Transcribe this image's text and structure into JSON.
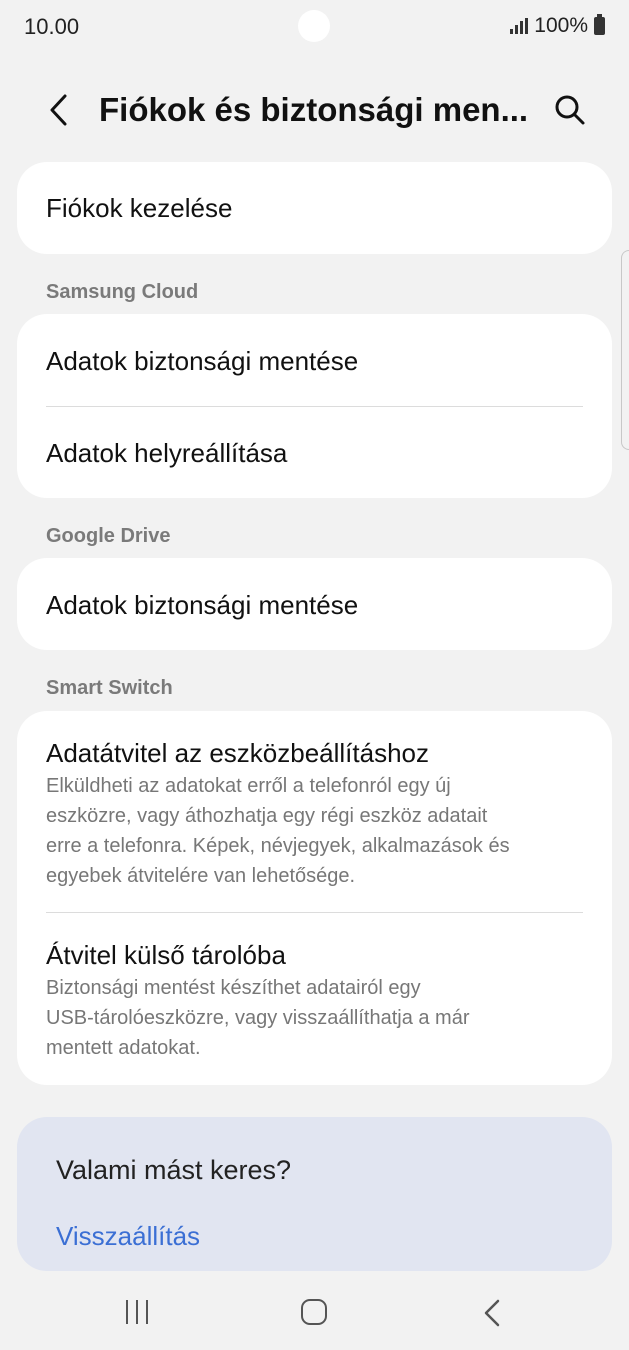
{
  "status_bar": {
    "time": "10.00",
    "battery": "100%"
  },
  "header": {
    "title": "Fiókok és biztonsági men...",
    "back_icon": "chevron-left-icon",
    "search_icon": "search-icon"
  },
  "manage_accounts": {
    "label": "Fiókok kezelése"
  },
  "samsung_cloud": {
    "section_label": "Samsung Cloud",
    "items": [
      {
        "title": "Adatok biztonsági mentése"
      },
      {
        "title": "Adatok helyreállítása"
      }
    ]
  },
  "google_drive": {
    "section_label": "Google Drive",
    "items": [
      {
        "title": "Adatok biztonsági mentése"
      }
    ]
  },
  "smart_switch": {
    "section_label": "Smart Switch",
    "items": [
      {
        "title": "Adatátvitel az eszközbeállításhoz",
        "desc_lines": [
          "Elküldheti az adatokat erről a telefonról egy új",
          "eszközre, vagy áthozhatja egy régi eszköz adatait",
          "erre a telefonra. Képek, névjegyek, alkalmazások és",
          "egyebek átvitelére van lehetősége."
        ]
      },
      {
        "title": "Átvitel külső tárolóba",
        "desc_lines": [
          "Biztonsági mentést készíthet adatairól egy",
          "USB-tárolóeszközre, vagy visszaállíthatja a már",
          "mentett adatokat."
        ]
      }
    ]
  },
  "suggestion": {
    "title": "Valami mást keres?",
    "link": "Visszaállítás"
  },
  "colors": {
    "background": "#f2f2f2",
    "card": "#ffffff",
    "suggestion_card": "#e1e5f1",
    "link": "#3b6fd4"
  }
}
